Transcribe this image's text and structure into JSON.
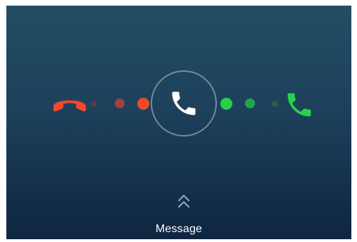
{
  "call_screen": {
    "background_top": "#234e65",
    "background_bottom": "#0f2640",
    "decline": {
      "icon": "phone-hangup-icon",
      "color": "#f0492c"
    },
    "answer": {
      "icon": "phone-answer-icon",
      "color": "#29d14a"
    },
    "center_handle": {
      "icon": "phone-icon",
      "color": "#ffffff"
    },
    "swipe_up": {
      "icon": "double-chevron-up-icon"
    },
    "message_label": "Message"
  }
}
